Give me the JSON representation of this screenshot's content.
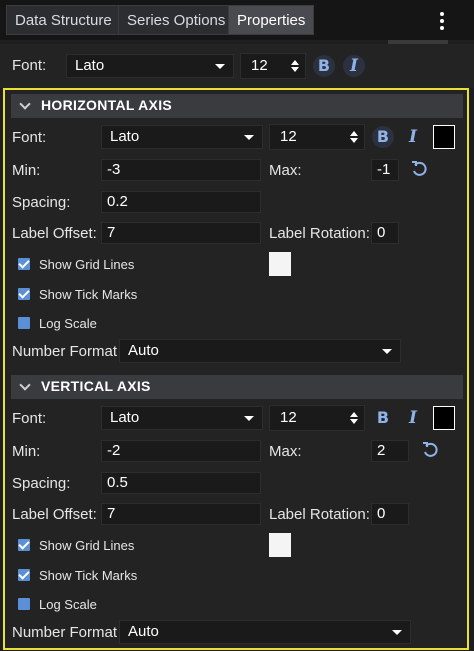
{
  "tabs": [
    {
      "label": "Data Structure",
      "active": false
    },
    {
      "label": "Series Options",
      "active": false
    },
    {
      "label": "Properties",
      "active": true
    }
  ],
  "top": {
    "font_label": "Font:",
    "font_value": "Lato",
    "size_value": "12",
    "bold_label": "B",
    "italic_label": "I"
  },
  "horizontal_axis": {
    "title": "HORIZONTAL AXIS",
    "font_label": "Font:",
    "font_value": "Lato",
    "size_value": "12",
    "bold_label": "B",
    "italic_label": "I",
    "color": "#000000",
    "min_label": "Min:",
    "min_value": "-3",
    "max_label": "Max:",
    "max_value": "-1",
    "spacing_label": "Spacing:",
    "spacing_value": "0.2",
    "label_offset_label": "Label Offset:",
    "label_offset_value": "7",
    "label_rotation_label": "Label Rotation:",
    "label_rotation_value": "0",
    "grid_lines_label": "Show Grid Lines",
    "grid_lines_checked": true,
    "grid_color": "#f4f4f4",
    "tick_marks_label": "Show Tick Marks",
    "tick_marks_checked": true,
    "log_scale_label": "Log Scale",
    "log_scale_checked": false,
    "number_format_label": "Number Format :",
    "number_format_value": "Auto"
  },
  "vertical_axis": {
    "title": "VERTICAL AXIS",
    "font_label": "Font:",
    "font_value": "Lato",
    "size_value": "12",
    "bold_label": "B",
    "italic_label": "I",
    "color": "#000000",
    "min_label": "Min:",
    "min_value": "-2",
    "max_label": "Max:",
    "max_value": "2",
    "spacing_label": "Spacing:",
    "spacing_value": "0.5",
    "label_offset_label": "Label Offset:",
    "label_offset_value": "7",
    "label_rotation_label": "Label Rotation:",
    "label_rotation_value": "0",
    "grid_lines_label": "Show Grid Lines",
    "grid_lines_checked": true,
    "grid_color": "#f4f4f4",
    "tick_marks_label": "Show Tick Marks",
    "tick_marks_checked": true,
    "log_scale_label": "Log Scale",
    "log_scale_checked": false,
    "number_format_label": "Number Format :",
    "number_format_value": "Auto"
  },
  "colors": {
    "highlight_border": "#e9e234",
    "accent": "#5b8fd6",
    "icon_blue": "#8fb3e8"
  }
}
